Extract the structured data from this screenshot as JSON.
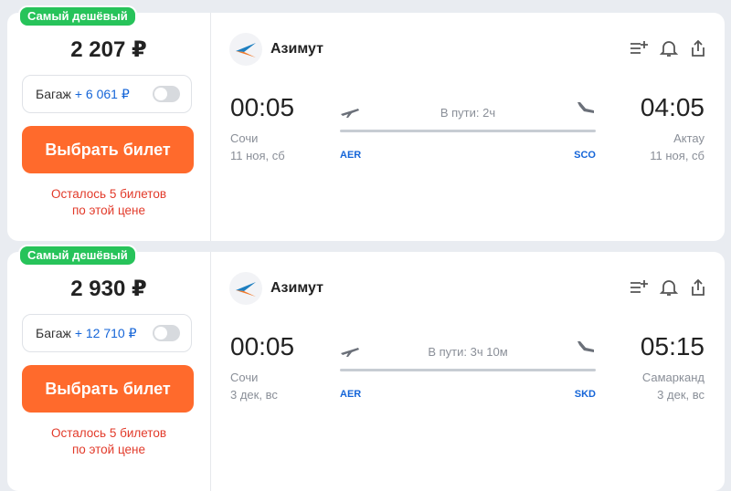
{
  "offers": [
    {
      "badge": "Самый дешёвый",
      "price": "2 207 ₽",
      "baggage": {
        "label": "Багаж",
        "price": "+ 6 061 ₽"
      },
      "buy_label": "Выбрать билет",
      "tickets_left": [
        "Осталось 5 билетов",
        "по этой цене"
      ],
      "airline": "Азимут",
      "departure": {
        "time": "00:05",
        "city": "Сочи",
        "date": "11 ноя, сб",
        "iata": "AER"
      },
      "arrival": {
        "time": "04:05",
        "city": "Актау",
        "date": "11 ноя, сб",
        "iata": "SCO"
      },
      "duration": "В пути: 2ч"
    },
    {
      "badge": "Самый дешёвый",
      "price": "2 930 ₽",
      "baggage": {
        "label": "Багаж",
        "price": "+ 12 710 ₽"
      },
      "buy_label": "Выбрать билет",
      "tickets_left": [
        "Осталось 5 билетов",
        "по этой цене"
      ],
      "airline": "Азимут",
      "departure": {
        "time": "00:05",
        "city": "Сочи",
        "date": "3 дек, вс",
        "iata": "AER"
      },
      "arrival": {
        "time": "05:15",
        "city": "Самарканд",
        "date": "3 дек, вс",
        "iata": "SKD"
      },
      "duration": "В пути: 3ч 10м"
    }
  ],
  "icons": [
    "filter-add-icon",
    "bell-icon",
    "share-icon",
    "plane-takeoff-icon",
    "plane-landing-icon",
    "airline-logo"
  ],
  "colors": {
    "badge": "#27c35a",
    "buy_button": "#ff6a2c",
    "accent_blue": "#1565d8",
    "warning_red": "#e23a2a"
  }
}
